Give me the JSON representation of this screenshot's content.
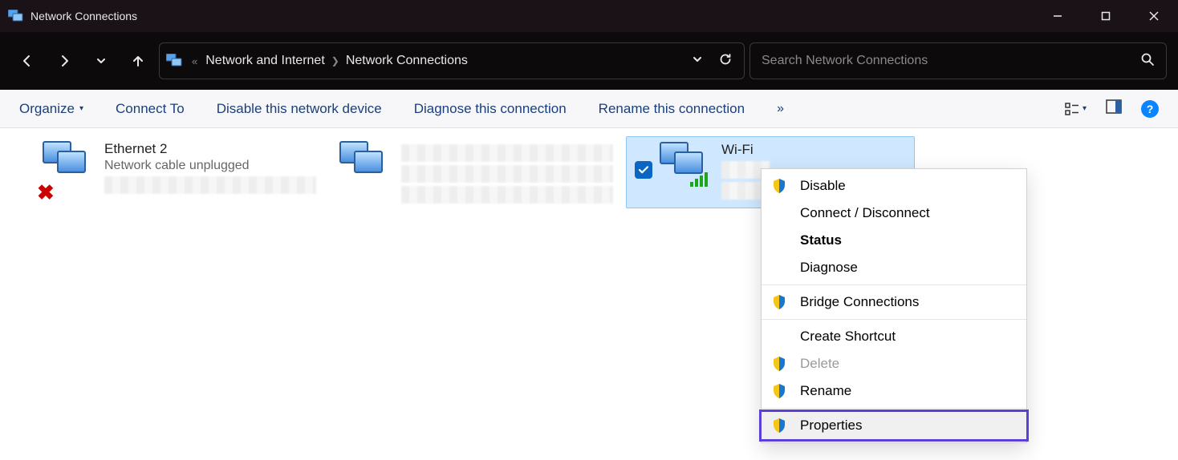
{
  "window": {
    "title": "Network Connections"
  },
  "breadcrumb": {
    "items": [
      "Network and Internet",
      "Network Connections"
    ]
  },
  "search": {
    "placeholder": "Search Network Connections"
  },
  "toolbar": {
    "organize": "Organize",
    "connect_to": "Connect To",
    "disable": "Disable this network device",
    "diagnose": "Diagnose this connection",
    "rename": "Rename this connection"
  },
  "adapters": [
    {
      "name": "Ethernet 2",
      "status": "Network cable unplugged",
      "error": true,
      "selected": false
    },
    {
      "name": "",
      "status": "",
      "error": false,
      "selected": false
    },
    {
      "name": "Wi-Fi",
      "status": "",
      "error": false,
      "selected": true
    }
  ],
  "context_menu": {
    "disable": "Disable",
    "connect_disconnect": "Connect / Disconnect",
    "status": "Status",
    "diagnose": "Diagnose",
    "bridge": "Bridge Connections",
    "create_shortcut": "Create Shortcut",
    "delete": "Delete",
    "rename": "Rename",
    "properties": "Properties"
  }
}
